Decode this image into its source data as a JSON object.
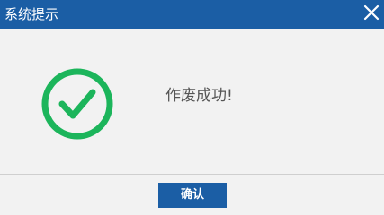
{
  "dialog": {
    "title": "系统提示",
    "close_icon": "close-icon",
    "message": "作废成功!",
    "status_icon": "success-check-icon",
    "confirm_label": "确认"
  },
  "colors": {
    "titlebar": "#1b5ea5",
    "success": "#1cb55b",
    "button": "#1b5ea5",
    "background": "#f2f2f2"
  }
}
